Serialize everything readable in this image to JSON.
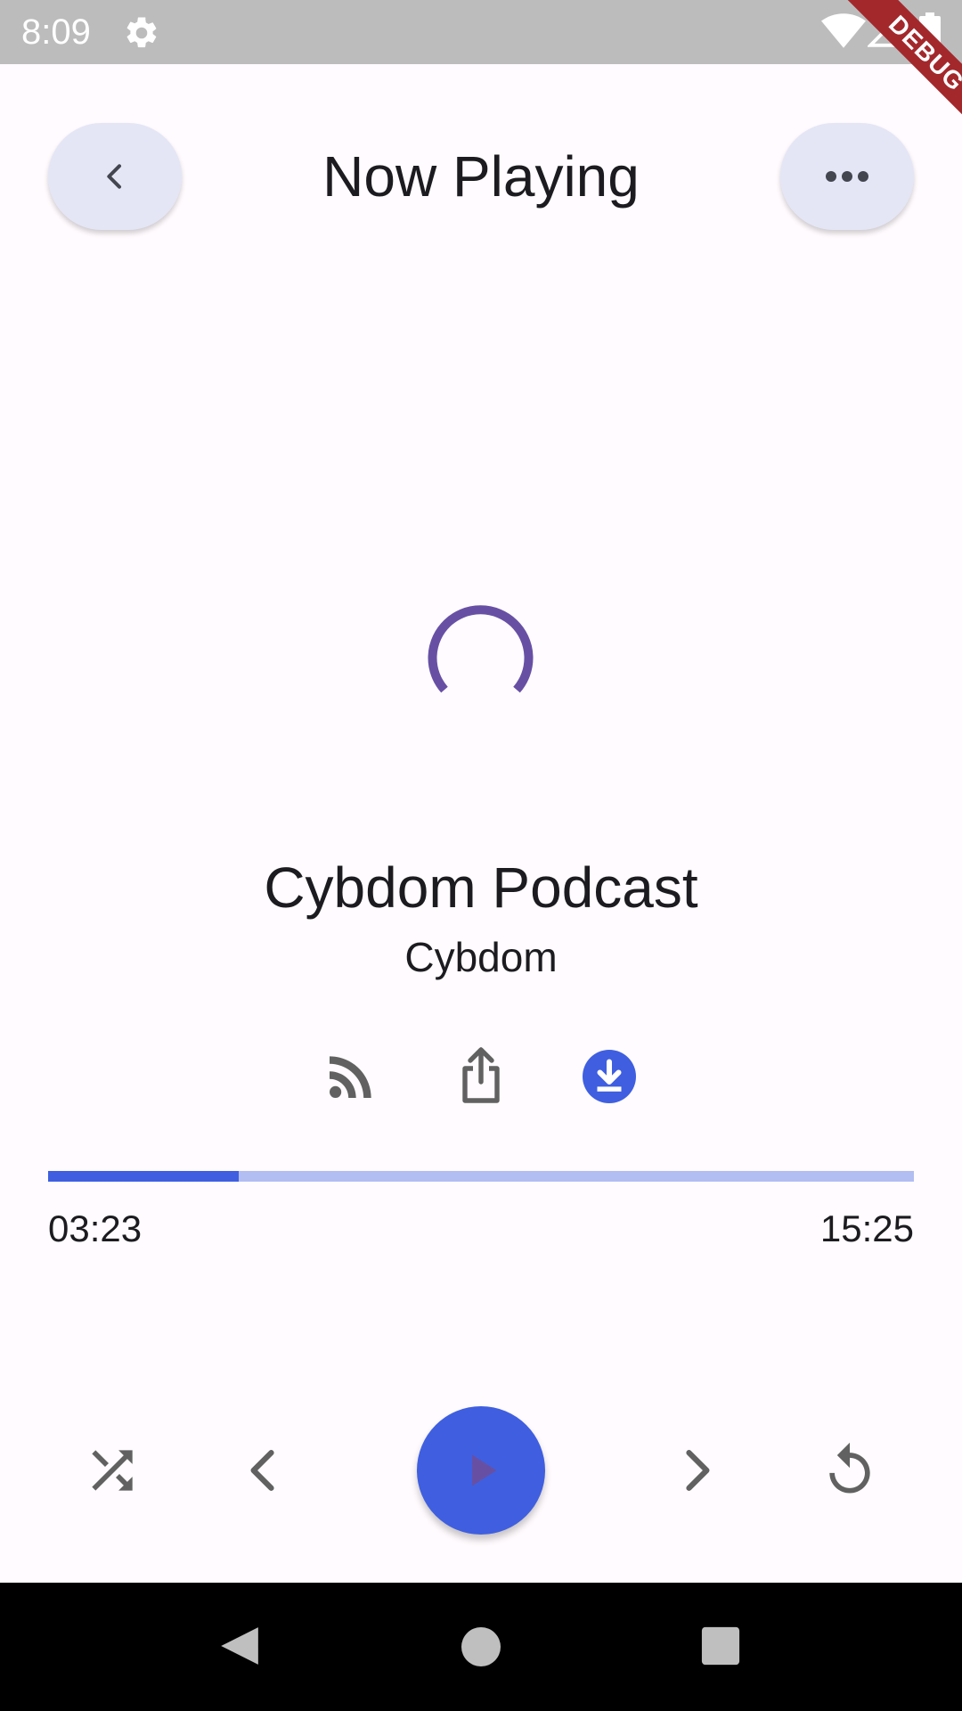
{
  "status_bar": {
    "time": "8:09",
    "debug_label": "DEBUG",
    "icons": [
      "gear-icon",
      "wifi-icon",
      "signal-icon",
      "battery-icon"
    ]
  },
  "header": {
    "title": "Now Playing",
    "back_icon": "chevron-left-icon",
    "more_icon": "more-horizontal-icon"
  },
  "loading_indicator": "circular-progress-icon",
  "track": {
    "title": "Cybdom Podcast",
    "artist": "Cybdom"
  },
  "actions": [
    {
      "name": "rss-feed",
      "icon": "rss-icon"
    },
    {
      "name": "share",
      "icon": "share-icon"
    },
    {
      "name": "download",
      "icon": "download-icon"
    }
  ],
  "progress": {
    "current_time": "03:23",
    "total_time": "15:25",
    "fraction": 0.22
  },
  "controls": {
    "shuffle_icon": "shuffle-icon",
    "previous_icon": "chevron-left-icon",
    "play_icon": "play-icon",
    "next_icon": "chevron-right-icon",
    "repeat_icon": "replay-icon"
  },
  "colors": {
    "accent": "#3f5fe0",
    "accent_light": "#b2bdf2",
    "spinner": "#6750a4",
    "header_button_bg": "#e4e6f6",
    "background": "#fffbfe"
  },
  "navigation_bar": [
    "back-icon",
    "home-icon",
    "recents-icon"
  ]
}
